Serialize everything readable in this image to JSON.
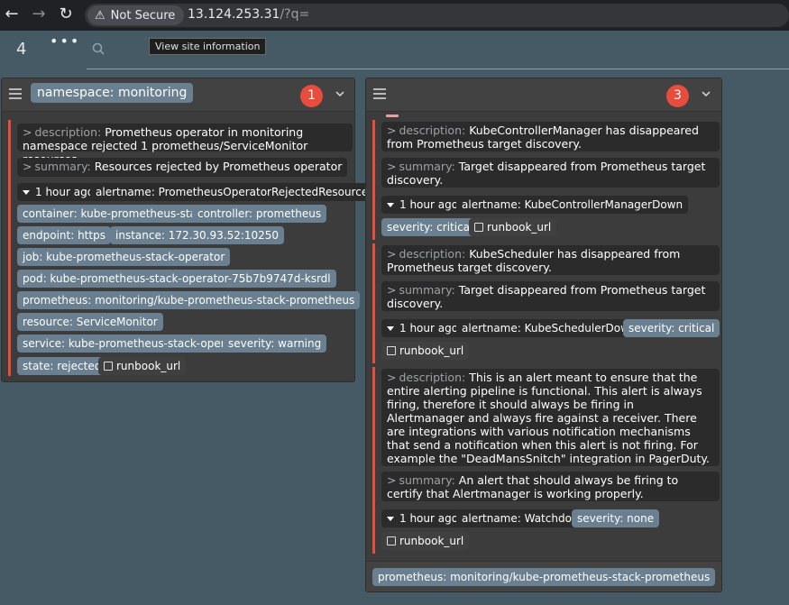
{
  "browser": {
    "security_label": "Not Secure",
    "url_host": "13.124.253.31",
    "url_path": "/?q=",
    "tooltip": "View site information"
  },
  "topbar": {
    "alert_count": "4",
    "menu_dots": "•••"
  },
  "groups": [
    {
      "title": "namespace: monitoring",
      "badge": "1",
      "alerts": [
        {
          "description_key": "description:",
          "description": "Prometheus operator in monitoring namespace rejected 1 prometheus/ServiceMonitor resources.",
          "summary_key": "summary:",
          "summary": "Resources rejected by Prometheus operator",
          "time": "1 hour ago",
          "alertname": "alertname: PrometheusOperatorRejectedResources",
          "labels": [
            "container: kube-prometheus-stack",
            "controller: prometheus",
            "endpoint: https",
            "instance: 172.30.93.52:10250",
            "job: kube-prometheus-stack-operator",
            "pod: kube-prometheus-stack-operator-75b7b9747d-ksrdl",
            "prometheus: monitoring/kube-prometheus-stack-prometheus",
            "resource: ServiceMonitor",
            "service: kube-prometheus-stack-operator",
            "severity: warning",
            "state: rejected"
          ],
          "link": "runbook_url"
        }
      ]
    },
    {
      "title": "",
      "badge": "3",
      "alerts": [
        {
          "description_key": "description:",
          "description": "KubeControllerManager has disappeared from Prometheus target discovery.",
          "summary_key": "summary:",
          "summary": "Target disappeared from Prometheus target discovery.",
          "time": "1 hour ago",
          "alertname": "alertname: KubeControllerManagerDown",
          "labels": [
            "severity: critical"
          ],
          "link": "runbook_url"
        },
        {
          "description_key": "description:",
          "description": "KubeScheduler has disappeared from Prometheus target discovery.",
          "summary_key": "summary:",
          "summary": "Target disappeared from Prometheus target discovery.",
          "time": "1 hour ago",
          "alertname": "alertname: KubeSchedulerDown",
          "labels": [
            "severity: critical"
          ],
          "link": "runbook_url"
        },
        {
          "description_key": "description:",
          "description": "This is an alert meant to ensure that the entire alerting pipeline is functional. This alert is always firing, therefore it should always be firing in Alertmanager and always fire against a receiver. There are integrations with various notification mechanisms that send a notification when this alert is not firing. For example the \"DeadMansSnitch\" integration in PagerDuty.",
          "summary_key": "summary:",
          "summary": "An alert that should always be firing to certify that Alertmanager is working properly.",
          "time": "1 hour ago",
          "alertname": "alertname: Watchdog",
          "labels": [
            "severity: none"
          ],
          "link": "runbook_url"
        }
      ],
      "footer_label": "prometheus: monitoring/kube-prometheus-stack-prometheus"
    }
  ],
  "colors": {
    "background": "#455a64",
    "accent_red": "#e74c3c",
    "label_slate": "#6a7f8f"
  }
}
